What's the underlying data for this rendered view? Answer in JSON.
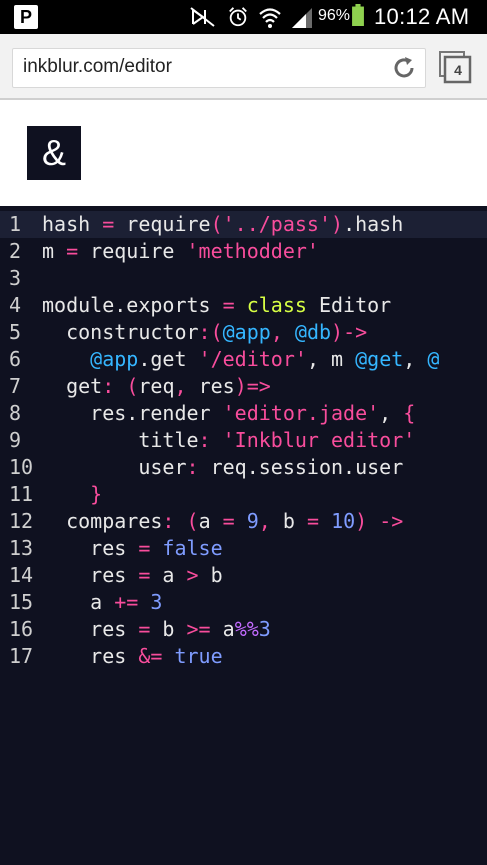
{
  "status": {
    "app_icon": "P",
    "icons": [
      "mute-icon",
      "alarm-icon",
      "wifi-icon",
      "signal-icon",
      "battery-icon"
    ],
    "battery": "96%",
    "time": "10:12 AM"
  },
  "browser": {
    "url": "inkblur.com/editor",
    "tab_count": "4"
  },
  "page": {
    "logo": "&"
  },
  "editor": {
    "lines": [
      {
        "n": "1",
        "tokens": [
          [
            "pl",
            "hash "
          ],
          [
            "op",
            "="
          ],
          [
            "pl",
            " require"
          ],
          [
            "op",
            "("
          ],
          [
            "str",
            "'../pass'"
          ],
          [
            "op",
            ")"
          ],
          [
            "pl",
            ".hash"
          ]
        ]
      },
      {
        "n": "2",
        "tokens": [
          [
            "pl",
            "m "
          ],
          [
            "op",
            "="
          ],
          [
            "pl",
            " require "
          ],
          [
            "str",
            "'methodder'"
          ]
        ]
      },
      {
        "n": "3",
        "tokens": []
      },
      {
        "n": "4",
        "tokens": [
          [
            "pl",
            "module.exports "
          ],
          [
            "op",
            "="
          ],
          [
            "pl",
            " "
          ],
          [
            "cls",
            "class"
          ],
          [
            "pl",
            " Editor"
          ]
        ]
      },
      {
        "n": "5",
        "tokens": [
          [
            "pl",
            "  constructor"
          ],
          [
            "op",
            ":("
          ],
          [
            "var",
            "@app"
          ],
          [
            "op",
            ","
          ],
          [
            "pl",
            " "
          ],
          [
            "var",
            "@db"
          ],
          [
            "op",
            ")->"
          ]
        ]
      },
      {
        "n": "6",
        "tokens": [
          [
            "pl",
            "    "
          ],
          [
            "var",
            "@app"
          ],
          [
            "pl",
            ".get "
          ],
          [
            "str",
            "'/editor'"
          ],
          [
            "pl",
            ", m "
          ],
          [
            "var",
            "@get"
          ],
          [
            "pl",
            ", "
          ],
          [
            "var",
            "@"
          ]
        ]
      },
      {
        "n": "7",
        "tokens": [
          [
            "pl",
            "  get"
          ],
          [
            "op",
            ":"
          ],
          [
            "pl",
            " "
          ],
          [
            "op",
            "("
          ],
          [
            "pl",
            "req"
          ],
          [
            "op",
            ","
          ],
          [
            "pl",
            " res"
          ],
          [
            "op",
            ")=>"
          ]
        ]
      },
      {
        "n": "8",
        "tokens": [
          [
            "pl",
            "    res.render "
          ],
          [
            "str",
            "'editor.jade'"
          ],
          [
            "pl",
            ", "
          ],
          [
            "op",
            "{"
          ]
        ]
      },
      {
        "n": "9",
        "tokens": [
          [
            "pl",
            "        title"
          ],
          [
            "op",
            ":"
          ],
          [
            "pl",
            " "
          ],
          [
            "str",
            "'Inkblur editor'"
          ]
        ]
      },
      {
        "n": "10",
        "tokens": [
          [
            "pl",
            "        user"
          ],
          [
            "op",
            ":"
          ],
          [
            "pl",
            " req.session.user"
          ]
        ]
      },
      {
        "n": "11",
        "tokens": [
          [
            "pl",
            "    "
          ],
          [
            "op",
            "}"
          ]
        ]
      },
      {
        "n": "12",
        "tokens": [
          [
            "pl",
            "  compares"
          ],
          [
            "op",
            ":"
          ],
          [
            "pl",
            " "
          ],
          [
            "op",
            "("
          ],
          [
            "pl",
            "a "
          ],
          [
            "op",
            "="
          ],
          [
            "pl",
            " "
          ],
          [
            "num",
            "9"
          ],
          [
            "op",
            ","
          ],
          [
            "pl",
            " b "
          ],
          [
            "op",
            "="
          ],
          [
            "pl",
            " "
          ],
          [
            "num",
            "10"
          ],
          [
            "op",
            ")"
          ],
          [
            "pl",
            " "
          ],
          [
            "op",
            "->"
          ]
        ]
      },
      {
        "n": "13",
        "tokens": [
          [
            "pl",
            "    res "
          ],
          [
            "op",
            "="
          ],
          [
            "pl",
            " "
          ],
          [
            "bool",
            "false"
          ]
        ]
      },
      {
        "n": "14",
        "tokens": [
          [
            "pl",
            "    res "
          ],
          [
            "op",
            "="
          ],
          [
            "pl",
            " a "
          ],
          [
            "op",
            ">"
          ],
          [
            "pl",
            " b"
          ]
        ]
      },
      {
        "n": "15",
        "tokens": [
          [
            "pl",
            "    a "
          ],
          [
            "op",
            "+="
          ],
          [
            "pl",
            " "
          ],
          [
            "num",
            "3"
          ]
        ]
      },
      {
        "n": "16",
        "tokens": [
          [
            "pl",
            "    res "
          ],
          [
            "op",
            "="
          ],
          [
            "pl",
            " b "
          ],
          [
            "op",
            ">="
          ],
          [
            "pl",
            " a"
          ],
          [
            "pur",
            "%%"
          ],
          [
            "num",
            "3"
          ]
        ]
      },
      {
        "n": "17",
        "tokens": [
          [
            "pl",
            "    res "
          ],
          [
            "op",
            "&="
          ],
          [
            "pl",
            " "
          ],
          [
            "bool",
            "true"
          ]
        ]
      }
    ]
  },
  "colors": {
    "editor_bg": "#0f1120",
    "keyword": "#f84d9c",
    "variable": "#35b6ff",
    "number": "#7f9cff",
    "class": "#d7ff44"
  }
}
